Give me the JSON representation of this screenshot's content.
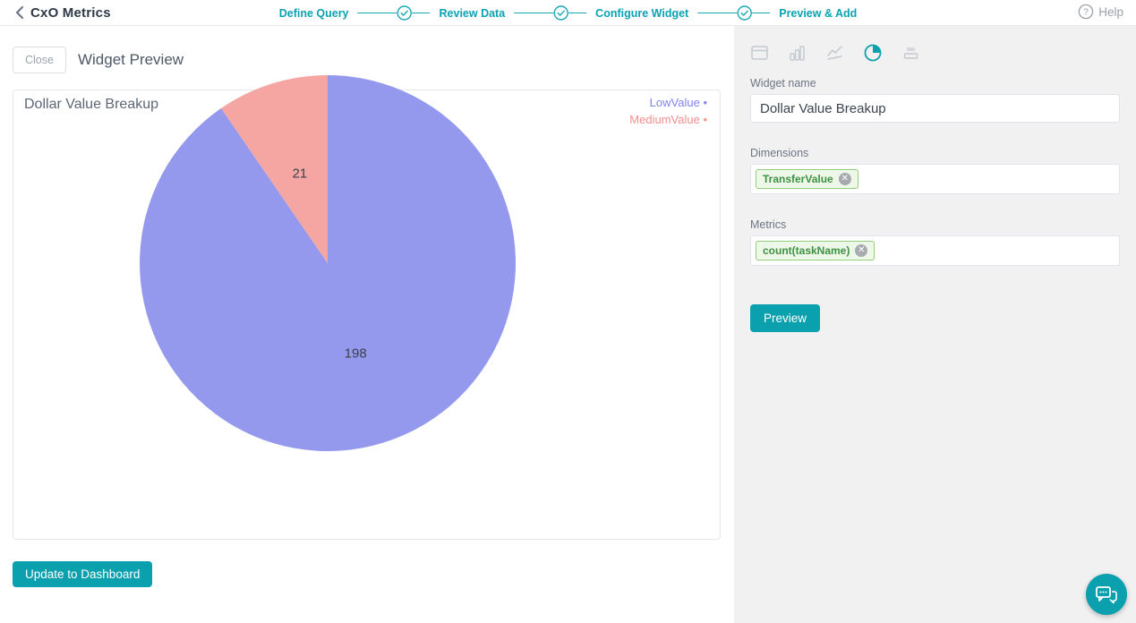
{
  "topbar": {
    "back_label": "CxO Metrics",
    "steps": [
      {
        "label": "Define Query"
      },
      {
        "label": "Review Data"
      },
      {
        "label": "Configure Widget"
      },
      {
        "label": "Preview & Add"
      }
    ],
    "help_label": "Help"
  },
  "preview_panel": {
    "close_label": "Close",
    "title": "Widget Preview",
    "update_button_label": "Update to Dashboard"
  },
  "chart_data": {
    "type": "pie",
    "title": "Dollar Value Breakup",
    "legend_position": "top-right",
    "slices": [
      {
        "label": "LowValue",
        "value": 198,
        "color": "#9499ee",
        "legend_color": "#8183f1"
      },
      {
        "label": "MediumValue",
        "value": 21,
        "color": "#f5a6a3",
        "legend_color": "#f28f8c"
      }
    ],
    "legend_bullet": "•",
    "data_label_color": "#3a4149"
  },
  "config_panel": {
    "chart_type_icons": [
      "table-icon",
      "bar-chart-icon",
      "line-chart-icon",
      "pie-chart-icon",
      "stacked-bar-icon"
    ],
    "selected_chart_type": "pie",
    "widget_name_label": "Widget name",
    "widget_name_value": "Dollar Value Breakup",
    "dimensions_label": "Dimensions",
    "dimension_chips": [
      {
        "label": "TransferValue"
      }
    ],
    "metrics_label": "Metrics",
    "metric_chips": [
      {
        "label": "count(taskName)"
      }
    ],
    "preview_button_label": "Preview"
  },
  "colors": {
    "accent_teal": "#0aa0ad",
    "stepper_teal": "#0aa2b2",
    "panel_bg": "#f1f1f2",
    "chip_bg": "#eef8e8",
    "chip_border": "#96cb7d",
    "chip_text": "#3e9143"
  }
}
